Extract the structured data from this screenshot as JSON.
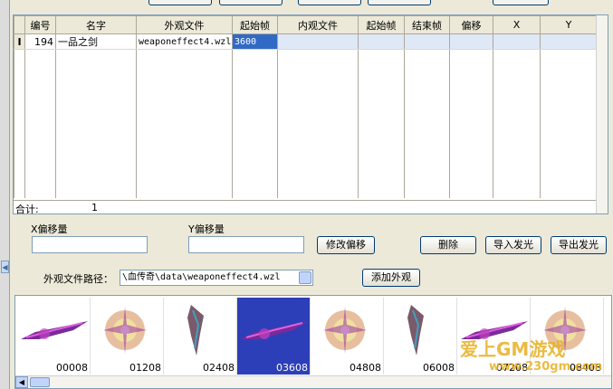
{
  "table": {
    "headers": [
      "编号",
      "名字",
      "外观文件",
      "起始帧",
      "内观文件",
      "起始帧",
      "结束帧",
      "偏移",
      "X",
      "Y"
    ],
    "row_indicator": "I",
    "rows": [
      {
        "id": "194",
        "name": "一品之剑",
        "outer_file": "weaponeffect4.wzl",
        "start_frame": "3600",
        "inner_file": "",
        "inner_start": "",
        "end_frame": "",
        "offset": "",
        "x": "",
        "y": ""
      }
    ],
    "footer_label": "合计:",
    "footer_count": "1"
  },
  "offset_panel": {
    "x_label": "X偏移量",
    "y_label": "Y偏移量",
    "x_value": "",
    "y_value": "",
    "modify_button": "修改偏移",
    "delete_button": "删除",
    "import_button": "导入发光",
    "export_button": "导出发光"
  },
  "path_panel": {
    "label": "外观文件路径：",
    "value": "\\血传奇\\data\\weaponeffect4.wzl",
    "add_button": "添加外观"
  },
  "thumbnails": [
    {
      "label": "00008",
      "icon": "sword-effect-icon",
      "selected": false
    },
    {
      "label": "01208",
      "icon": "burst-effect-icon",
      "selected": false
    },
    {
      "label": "02408",
      "icon": "blade-effect-icon",
      "selected": false
    },
    {
      "label": "03608",
      "icon": "sword-effect-icon",
      "selected": true
    },
    {
      "label": "04808",
      "icon": "burst-effect-icon",
      "selected": false
    },
    {
      "label": "06008",
      "icon": "blade-effect-icon",
      "selected": false
    },
    {
      "label": "07208",
      "icon": "sword-effect-icon",
      "selected": false
    },
    {
      "label": "08408",
      "icon": "burst-effect-icon",
      "selected": false
    }
  ],
  "watermark": {
    "line1": "爱上GM游戏",
    "line2": "www.230gm.com"
  },
  "colors": {
    "selection": "#316ac5",
    "thumb_selected": "#2d3fb8",
    "border": "#7f9db9",
    "face": "#ece9d8"
  }
}
